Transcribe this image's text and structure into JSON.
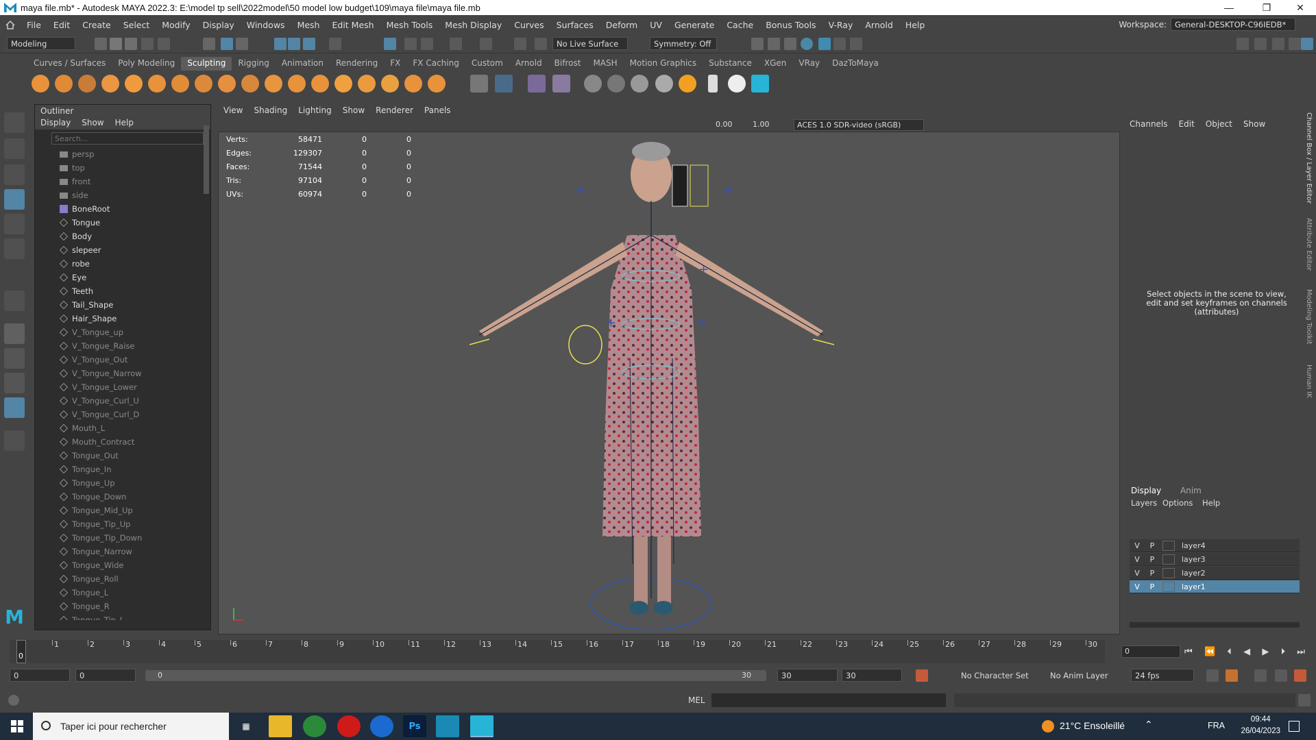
{
  "window": {
    "title": "maya file.mb* - Autodesk MAYA 2022.3: E:\\model tp sell\\2022model\\50 model low budget\\109\\maya file\\maya file.mb",
    "minimize": "—",
    "maximize": "❐",
    "close": "✕"
  },
  "menus": [
    "File",
    "Edit",
    "Create",
    "Select",
    "Modify",
    "Display",
    "Windows",
    "Mesh",
    "Edit Mesh",
    "Mesh Tools",
    "Mesh Display",
    "Curves",
    "Surfaces",
    "Deform",
    "UV",
    "Generate",
    "Cache",
    "Bonus Tools",
    "V-Ray",
    "Arnold",
    "Help"
  ],
  "workspace": {
    "label": "Workspace:",
    "value": "General-DESKTOP-C96IEDB*"
  },
  "statusline": {
    "mode": "Modeling",
    "live_surface": "No Live Surface",
    "symmetry": "Symmetry: Off"
  },
  "shelf_tabs": [
    "Curves / Surfaces",
    "Poly Modeling",
    "Sculpting",
    "Rigging",
    "Animation",
    "Rendering",
    "FX",
    "FX Caching",
    "Custom",
    "Arnold",
    "Bifrost",
    "MASH",
    "Motion Graphics",
    "Substance",
    "XGen",
    "VRay",
    "DazToMaya"
  ],
  "shelf_active": "Sculpting",
  "outliner": {
    "title": "Outliner",
    "menu": [
      "Display",
      "Show",
      "Help"
    ],
    "search_placeholder": "Search...",
    "items": [
      {
        "label": "persp",
        "kind": "camera",
        "dim": true
      },
      {
        "label": "top",
        "kind": "camera",
        "dim": true
      },
      {
        "label": "front",
        "kind": "camera",
        "dim": true
      },
      {
        "label": "side",
        "kind": "camera",
        "dim": true
      },
      {
        "label": "BoneRoot",
        "kind": "joint",
        "dim": false
      },
      {
        "label": "Tongue",
        "kind": "mesh",
        "dim": false
      },
      {
        "label": "Body",
        "kind": "mesh",
        "dim": false
      },
      {
        "label": "slepeer",
        "kind": "mesh",
        "dim": false
      },
      {
        "label": "robe",
        "kind": "mesh",
        "dim": false
      },
      {
        "label": "Eye",
        "kind": "mesh",
        "dim": false
      },
      {
        "label": "Teeth",
        "kind": "mesh",
        "dim": false
      },
      {
        "label": "Tail_Shape",
        "kind": "mesh",
        "dim": false
      },
      {
        "label": "Hair_Shape",
        "kind": "mesh",
        "dim": false
      },
      {
        "label": "V_Tongue_up",
        "kind": "mesh",
        "dim": true
      },
      {
        "label": "V_Tongue_Raise",
        "kind": "mesh",
        "dim": true
      },
      {
        "label": "V_Tongue_Out",
        "kind": "mesh",
        "dim": true
      },
      {
        "label": "V_Tongue_Narrow",
        "kind": "mesh",
        "dim": true
      },
      {
        "label": "V_Tongue_Lower",
        "kind": "mesh",
        "dim": true
      },
      {
        "label": "V_Tongue_Curl_U",
        "kind": "mesh",
        "dim": true
      },
      {
        "label": "V_Tongue_Curl_D",
        "kind": "mesh",
        "dim": true
      },
      {
        "label": "Mouth_L",
        "kind": "mesh",
        "dim": true
      },
      {
        "label": "Mouth_Contract",
        "kind": "mesh",
        "dim": true
      },
      {
        "label": "Tongue_Out",
        "kind": "mesh",
        "dim": true
      },
      {
        "label": "Tongue_In",
        "kind": "mesh",
        "dim": true
      },
      {
        "label": "Tongue_Up",
        "kind": "mesh",
        "dim": true
      },
      {
        "label": "Tongue_Down",
        "kind": "mesh",
        "dim": true
      },
      {
        "label": "Tongue_Mid_Up",
        "kind": "mesh",
        "dim": true
      },
      {
        "label": "Tongue_Tip_Up",
        "kind": "mesh",
        "dim": true
      },
      {
        "label": "Tongue_Tip_Down",
        "kind": "mesh",
        "dim": true
      },
      {
        "label": "Tongue_Narrow",
        "kind": "mesh",
        "dim": true
      },
      {
        "label": "Tongue_Wide",
        "kind": "mesh",
        "dim": true
      },
      {
        "label": "Tongue_Roll",
        "kind": "mesh",
        "dim": true
      },
      {
        "label": "Tongue_L",
        "kind": "mesh",
        "dim": true
      },
      {
        "label": "Tongue_R",
        "kind": "mesh",
        "dim": true
      },
      {
        "label": "Tongue_Tip_L",
        "kind": "mesh",
        "dim": true
      }
    ]
  },
  "viewport": {
    "menu": [
      "View",
      "Shading",
      "Lighting",
      "Show",
      "Renderer",
      "Panels"
    ],
    "exposure": "0.00",
    "gamma": "1.00",
    "colorspace": "ACES 1.0 SDR-video (sRGB)",
    "hud": [
      {
        "label": "Verts:",
        "v": "58471",
        "a": "0",
        "b": "0"
      },
      {
        "label": "Edges:",
        "v": "129307",
        "a": "0",
        "b": "0"
      },
      {
        "label": "Faces:",
        "v": "71544",
        "a": "0",
        "b": "0"
      },
      {
        "label": "Tris:",
        "v": "97104",
        "a": "0",
        "b": "0"
      },
      {
        "label": "UVs:",
        "v": "60974",
        "a": "0",
        "b": "0"
      }
    ]
  },
  "channelbox": {
    "tabs": [
      "Channels",
      "Edit",
      "Object",
      "Show"
    ],
    "help": "Select objects in the scene to view, edit and set keyframes on channels (attributes)"
  },
  "side_tabs": [
    "Channel Box / Layer Editor",
    "Attribute Editor",
    "Modeling Toolkit",
    "Human IK"
  ],
  "layers": {
    "tabs": [
      "Display",
      "Anim"
    ],
    "menu": [
      "Layers",
      "Options",
      "Help"
    ],
    "rows": [
      {
        "v": "V",
        "p": "P",
        "name": "layer4",
        "selected": false
      },
      {
        "v": "V",
        "p": "P",
        "name": "layer3",
        "selected": false
      },
      {
        "v": "V",
        "p": "P",
        "name": "layer2",
        "selected": false
      },
      {
        "v": "V",
        "p": "P",
        "name": "layer1",
        "selected": true
      }
    ]
  },
  "timeline": {
    "frames": [
      "0",
      "1",
      "2",
      "3",
      "4",
      "5",
      "6",
      "7",
      "8",
      "9",
      "10",
      "11",
      "12",
      "13",
      "14",
      "15",
      "16",
      "17",
      "18",
      "19",
      "20",
      "21",
      "22",
      "23",
      "24",
      "25",
      "26",
      "27",
      "28",
      "29",
      "30"
    ],
    "current": "0",
    "current_field": "0"
  },
  "range": {
    "start": "0",
    "anim_start": "0",
    "slider_start": "0",
    "slider_end": "30",
    "end": "30",
    "anim_end": "30",
    "character_set": "No Character Set",
    "anim_layer": "No Anim Layer",
    "fps": "24 fps"
  },
  "cmdline": {
    "lang": "MEL"
  },
  "taskbar": {
    "search": "Taper ici pour rechercher",
    "weather": "21°C Ensoleillé",
    "lang": "FRA",
    "time": "09:44",
    "date": "26/04/2023"
  },
  "colors": {
    "accent": "#5285a6",
    "active_tool": "#5285a6",
    "taskbar": "#1f2d3d"
  }
}
